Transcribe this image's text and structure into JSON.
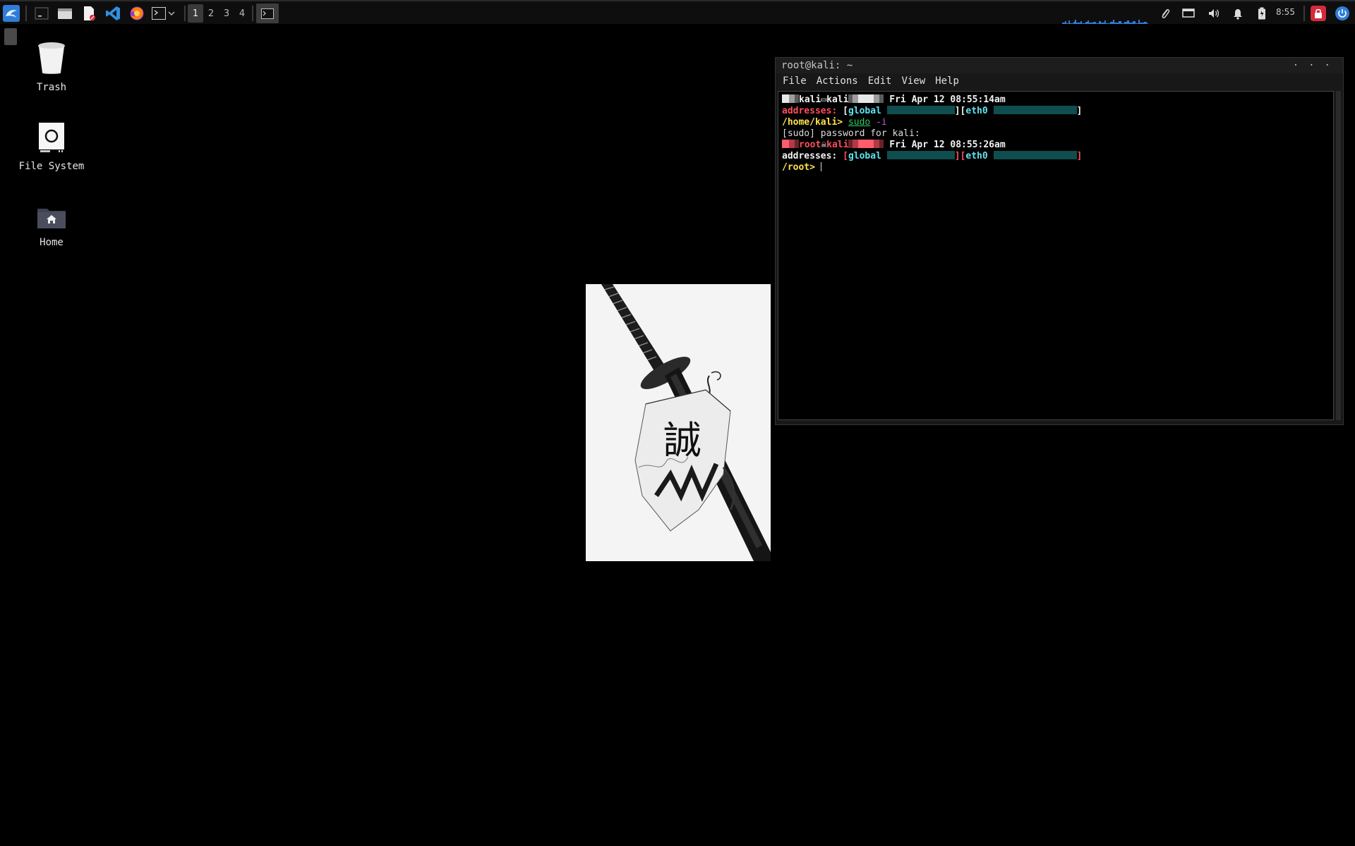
{
  "panel": {
    "workspaces": [
      "1",
      "2",
      "3",
      "4"
    ],
    "active_workspace": "1",
    "clock": "8:55",
    "icons": {
      "menu": "kali-dragon-icon",
      "show_desktop": "show-desktop-icon",
      "files": "file-manager-icon",
      "editor": "text-editor-icon",
      "vscode": "vscode-icon",
      "firefox": "firefox-icon",
      "terminal": "terminal-icon",
      "dropdown": "chevron-down-icon",
      "paperclip": "paperclip-icon",
      "display": "display-icon",
      "volume": "volume-icon",
      "notifications": "bell-icon",
      "battery": "battery-icon",
      "lock": "lock-icon",
      "power": "power-icon"
    },
    "colors": {
      "accent_blue": "#2f7dd8",
      "lock_red": "#d42a3a"
    }
  },
  "desktop": {
    "icons": [
      {
        "label": "Trash",
        "icon": "trash-icon"
      },
      {
        "label": "File System",
        "icon": "drive-icon"
      },
      {
        "label": "Home",
        "icon": "home-folder-icon"
      }
    ]
  },
  "terminal": {
    "title": "root@kali: ~",
    "menu": [
      "File",
      "Actions",
      "Edit",
      "View",
      "Help"
    ],
    "lines": {
      "l1_user": "kali",
      "l1_host": "kali",
      "l1_date": "Fri Apr 12 08:55:14am",
      "l2_addresses": "addresses:",
      "l2_global": "global",
      "l2_eth": "eth0",
      "l3_path": "/home/kali>",
      "l3_cmd": "sudo",
      "l3_flag": "-i",
      "l4_text": "[sudo] password for kali:",
      "l5_user": "root",
      "l5_host": "kali",
      "l5_date": "Fri Apr 12 08:55:26am",
      "l6_addresses": "addresses:",
      "l6_global": "global",
      "l6_eth": "eth0",
      "l7_path": "/root>"
    }
  },
  "wallpaper": {
    "artwork": "katana-with-banner-artwork",
    "banner_glyph": "誠"
  }
}
